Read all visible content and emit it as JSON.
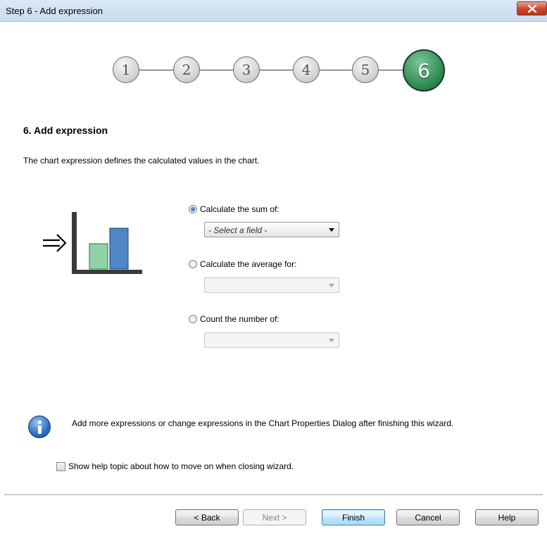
{
  "window": {
    "title": "Step 6 - Add expression"
  },
  "steps": [
    "1",
    "2",
    "3",
    "4",
    "5",
    "6"
  ],
  "active_step": "6",
  "section_title": "6. Add expression",
  "description": "The chart expression defines the calculated values in the chart.",
  "options": {
    "sum": {
      "label": "Calculate the sum of:",
      "checked": true,
      "field_value": "- Select a field -"
    },
    "average": {
      "label": "Calculate the average for:",
      "checked": false,
      "field_value": ""
    },
    "count": {
      "label": "Count the number of:",
      "checked": false,
      "field_value": ""
    }
  },
  "info_text": "Add more expressions or change expressions in the Chart Properties Dialog after finishing this wizard.",
  "help_checkbox": {
    "label": "Show help topic about how to move on when closing wizard.",
    "checked": false
  },
  "buttons": {
    "back": "< Back",
    "next": "Next >",
    "finish": "Finish",
    "cancel": "Cancel",
    "help": "Help"
  },
  "colors": {
    "active_step": "#2e8a52",
    "bar_green": "#8fd3a6",
    "bar_blue": "#4f86c6",
    "close_button": "#c9462c"
  },
  "icons": [
    "close-icon",
    "arrow-right-icon",
    "bar-chart-icon",
    "info-icon",
    "dropdown-arrow-icon"
  ]
}
